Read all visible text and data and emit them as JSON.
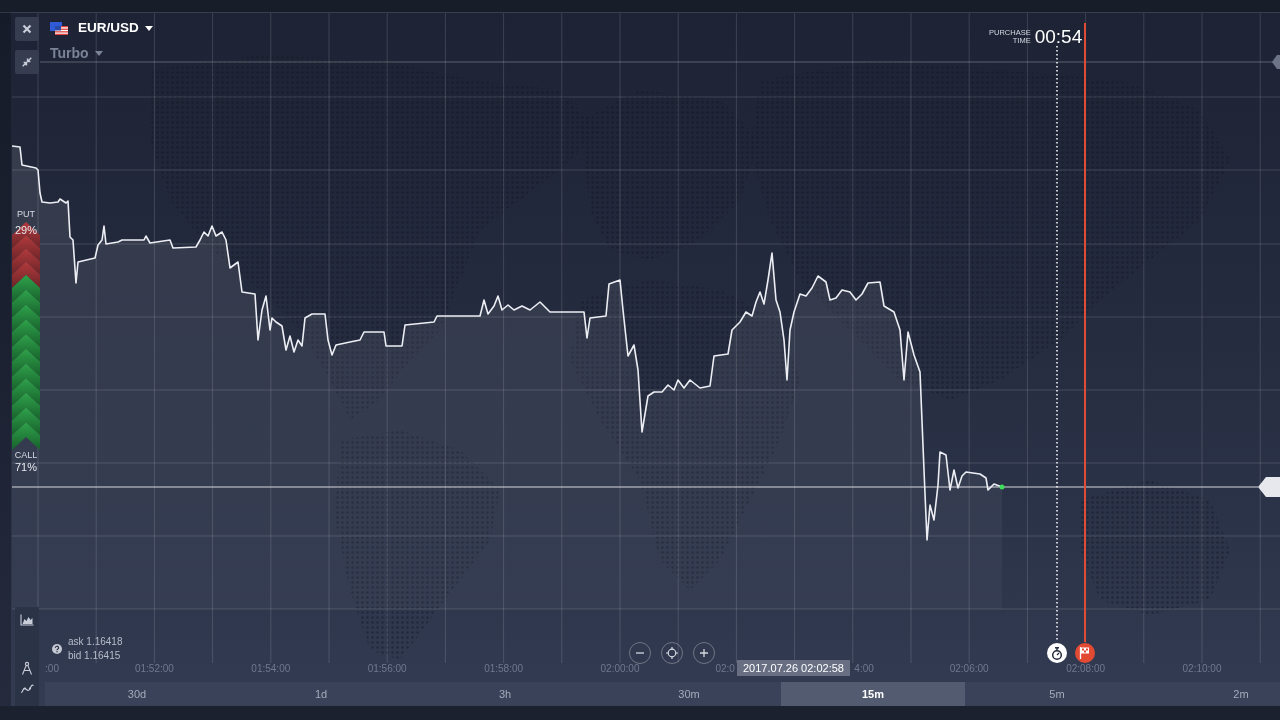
{
  "asset": {
    "name": "EUR/USD",
    "option_type": "Turbo"
  },
  "purchase_time": {
    "label": "PURCHASE TIME",
    "value": "00:54"
  },
  "sentiment": {
    "put_label": "PUT",
    "put_share": "29%",
    "level": 0.29,
    "call_label": "CALL",
    "call_share": "71%"
  },
  "quote": {
    "ask": "ask 1.16418",
    "bid": "bid 1.16415"
  },
  "time_axis": [
    {
      "label": ":00",
      "cut_left": true,
      "cut_right": false
    },
    {
      "label": "01:52:00",
      "cut_left": false,
      "cut_right": false
    },
    {
      "label": "01:54:00",
      "cut_left": false,
      "cut_right": false
    },
    {
      "label": "01:56:00",
      "cut_left": false,
      "cut_right": false
    },
    {
      "label": "01:58:00",
      "cut_left": false,
      "cut_right": false
    },
    {
      "label": "02:00:00",
      "cut_left": false,
      "cut_right": false
    },
    {
      "label": "02:0",
      "cut_left": false,
      "cut_right": true
    },
    {
      "label": "4:00",
      "cut_left": true,
      "cut_right": false
    },
    {
      "label": "02:06:00",
      "cut_left": false,
      "cut_right": false
    },
    {
      "label": "02:08:00",
      "cut_left": false,
      "cut_right": false
    },
    {
      "label": "02:10:00",
      "cut_left": false,
      "cut_right": false
    }
  ],
  "crosshair_time": "2017.07.26 02:02:58",
  "periods": [
    {
      "label": "30d",
      "selected": false
    },
    {
      "label": "1d",
      "selected": false
    },
    {
      "label": "3h",
      "selected": false
    },
    {
      "label": "30m",
      "selected": false
    },
    {
      "label": "15m",
      "selected": true
    },
    {
      "label": "5m",
      "selected": false
    },
    {
      "label": "2m",
      "selected": false
    }
  ]
}
